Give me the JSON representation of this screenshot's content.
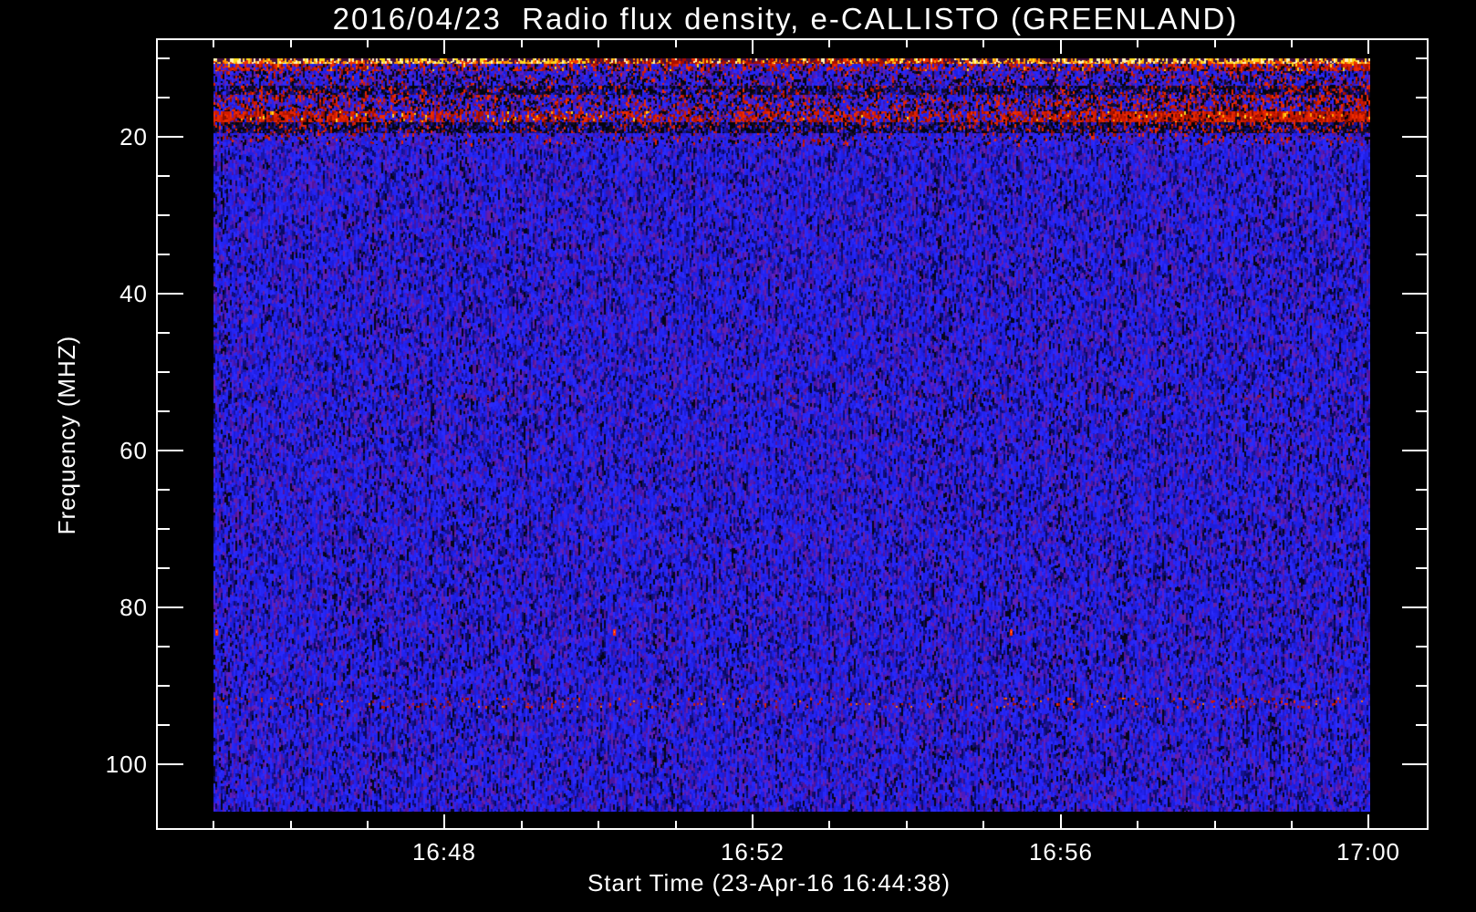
{
  "figure": {
    "background_color": "#000000",
    "axis_color": "#ffffff"
  },
  "chart_data": {
    "type": "heatmap",
    "subtype": "radio-spectrogram",
    "title": "2016/04/23  Radio flux density, e-CALLISTO (GREENLAND)",
    "xlabel": "Start Time (23-Apr-16 16:44:38)",
    "ylabel": "Frequency (MHZ)",
    "date": "2016/04/23",
    "instrument": "e-CALLISTO",
    "station": "GREENLAND",
    "start_time": "16:44:38",
    "end_time": "17:00:00",
    "x_tick_labels": [
      "16:48",
      "16:52",
      "16:56",
      "17:00"
    ],
    "x_minor_tick_interval": "1 min",
    "y_tick_labels": [
      "20",
      "40",
      "60",
      "80",
      "100"
    ],
    "y_tick_values": [
      20,
      40,
      60,
      80,
      100
    ],
    "y_minor_tick_interval_mhz": 5,
    "y_axis_range_mhz": [
      7.6,
      108.8
    ],
    "data_freq_range_mhz": [
      10.0,
      106.1
    ],
    "y_axis_inverted": true,
    "grid": false,
    "legend": false,
    "colormap": {
      "quiet_blue": "#2121ec",
      "striation_purple": "#4c1ac0",
      "deep_blue": "#16128e",
      "low_black": "#06051a",
      "rfi_red": "#d21a00",
      "rfi_orange": "#ff9100",
      "rfi_yellow": "#ffd91e",
      "rfi_white": "#fff2b4"
    },
    "bands": [
      {
        "freq_mhz": [
          10.0,
          10.7
        ],
        "kind": "bright_stripe",
        "desc": "intense narrow RFI stripe, yellow/white/orange, strongest at left and right"
      },
      {
        "freq_mhz": [
          10.7,
          11.7
        ],
        "kind": "red_mottle",
        "desc": "dense red interference mottling"
      },
      {
        "freq_mhz": [
          11.7,
          13.5
        ],
        "kind": "blue_specks",
        "desc": "blue with scattered red and black specks"
      },
      {
        "freq_mhz": [
          13.5,
          14.7
        ],
        "kind": "dark_band",
        "desc": "dark absorption-like band with red specks"
      },
      {
        "freq_mhz": [
          14.7,
          16.8
        ],
        "kind": "mixed_rfi",
        "desc": "mixed blue/black/red noise"
      },
      {
        "freq_mhz": [
          16.8,
          18.2
        ],
        "kind": "red_row",
        "desc": "strong red RFI row with yellow bursts"
      },
      {
        "freq_mhz": [
          18.2,
          19.6
        ],
        "kind": "dark_band",
        "desc": "dark band"
      },
      {
        "freq_mhz": [
          19.6,
          21.0
        ],
        "kind": "fade",
        "desc": "transition to quiet background"
      },
      {
        "freq_mhz": [
          52.6,
          53.8
        ],
        "kind": "faint_red_line",
        "desc": "very faint reddish horizontal trace"
      },
      {
        "freq_mhz": [
          91.6,
          93.0
        ],
        "kind": "red_speckle_line",
        "desc": "faint red-speckled horizontal line across full time range"
      }
    ],
    "rfi_right_boost_from_time_frac": 0.64,
    "point_features": [
      {
        "time_frac": 0.002,
        "freq_mhz": 83.2,
        "desc": "small bright red dot"
      },
      {
        "time_frac": 0.346,
        "freq_mhz": 83.2,
        "desc": "small bright red dot"
      },
      {
        "time_frac": 0.689,
        "freq_mhz": 83.2,
        "desc": "small bright red dot"
      }
    ]
  }
}
